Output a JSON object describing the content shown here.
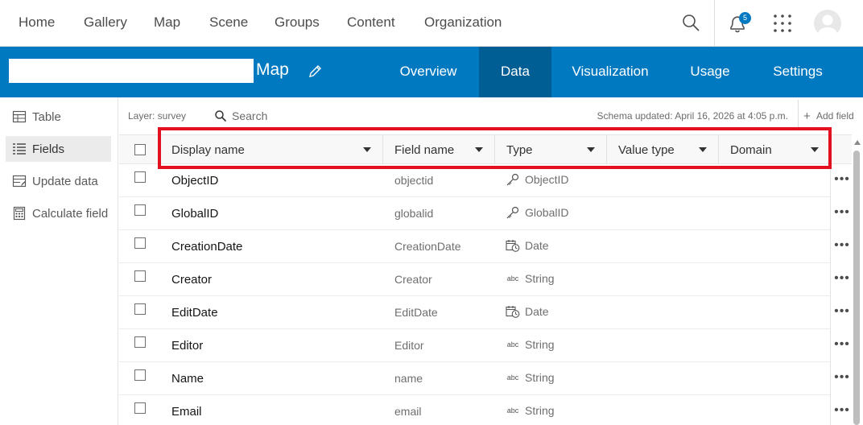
{
  "nav": {
    "items": [
      "Home",
      "Gallery",
      "Map",
      "Scene",
      "Groups",
      "Content",
      "Organization"
    ],
    "notification_count": "5"
  },
  "item": {
    "title_suffix": "Map",
    "tabs": [
      "Overview",
      "Data",
      "Visualization",
      "Usage",
      "Settings"
    ],
    "active_tab": "Data"
  },
  "sidebar": {
    "items": [
      {
        "label": "Table",
        "icon": "table-icon"
      },
      {
        "label": "Fields",
        "icon": "fields-icon"
      },
      {
        "label": "Update data",
        "icon": "update-data-icon"
      },
      {
        "label": "Calculate field",
        "icon": "calculator-icon"
      }
    ],
    "active": "Fields"
  },
  "toolbar": {
    "layer_label": "Layer: survey",
    "search_placeholder": "Search",
    "schema_updated": "Schema updated: April 16, 2026 at 4:05 p.m.",
    "add_field_label": "Add field"
  },
  "table": {
    "columns": [
      "Display name",
      "Field name",
      "Type",
      "Value type",
      "Domain"
    ],
    "rows": [
      {
        "display": "ObjectID",
        "field": "objectid",
        "type": "ObjectID",
        "type_icon": "key-icon"
      },
      {
        "display": "GlobalID",
        "field": "globalid",
        "type": "GlobalID",
        "type_icon": "key-icon"
      },
      {
        "display": "CreationDate",
        "field": "CreationDate",
        "type": "Date",
        "type_icon": "calendar-clock-icon"
      },
      {
        "display": "Creator",
        "field": "Creator",
        "type": "String",
        "type_icon": "abc-icon"
      },
      {
        "display": "EditDate",
        "field": "EditDate",
        "type": "Date",
        "type_icon": "calendar-clock-icon"
      },
      {
        "display": "Editor",
        "field": "Editor",
        "type": "String",
        "type_icon": "abc-icon"
      },
      {
        "display": "Name",
        "field": "name",
        "type": "String",
        "type_icon": "abc-icon"
      },
      {
        "display": "Email",
        "field": "email",
        "type": "String",
        "type_icon": "abc-icon"
      }
    ],
    "abc_glyph": "abc"
  },
  "colors": {
    "brand_blue": "#0079c1",
    "active_tab": "#005e95",
    "highlight": "#e3101f"
  }
}
